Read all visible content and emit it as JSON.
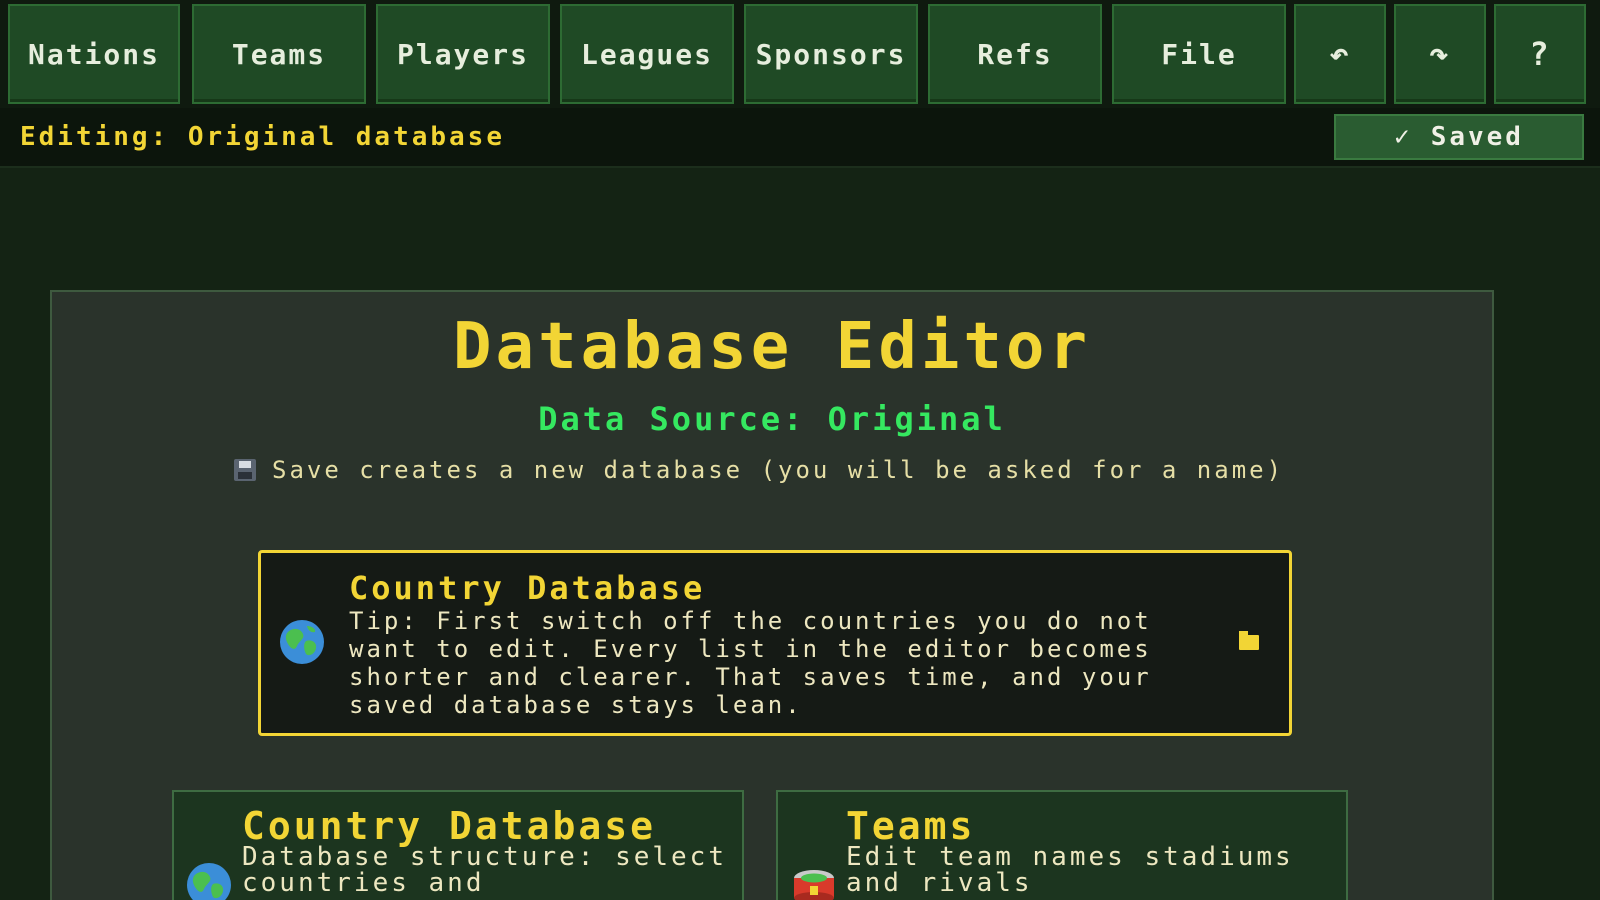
{
  "nav": {
    "items": [
      {
        "label": "Nations"
      },
      {
        "label": "Teams"
      },
      {
        "label": "Players"
      },
      {
        "label": "Leagues"
      },
      {
        "label": "Sponsors"
      },
      {
        "label": "Refs"
      },
      {
        "label": "File"
      }
    ],
    "undo_glyph": "↶",
    "redo_glyph": "↷",
    "help_glyph": "?"
  },
  "status": {
    "editing": "Editing: Original database",
    "saved_check": "✓",
    "saved_label": "Saved"
  },
  "main": {
    "title": "Database Editor",
    "subtitle": "Data Source: Original",
    "save_note": "Save creates a new database (you will be asked for a name)",
    "tip": {
      "title": "Country Database",
      "text": "Tip: First switch off the countries you do not want to edit. Every list in the editor becomes shorter and clearer. That saves time, and your saved database stays lean."
    },
    "cards": [
      {
        "title": "Country Database",
        "text": "Database structure: select countries and"
      },
      {
        "title": "Teams",
        "text": "Edit team names stadiums and rivals"
      }
    ]
  },
  "colors": {
    "accent_yellow": "#f2d535",
    "accent_green": "#35e860",
    "nav_button": "#1f4a25",
    "background": "#142314"
  },
  "icons": {
    "undo": "undo-icon",
    "redo": "redo-icon",
    "help": "help-icon",
    "save_note": "floppy-disk-icon",
    "tip": "globe-icon",
    "tip_action": "folder-icon",
    "card_country": "globe-icon",
    "card_teams": "stadium-icon"
  }
}
